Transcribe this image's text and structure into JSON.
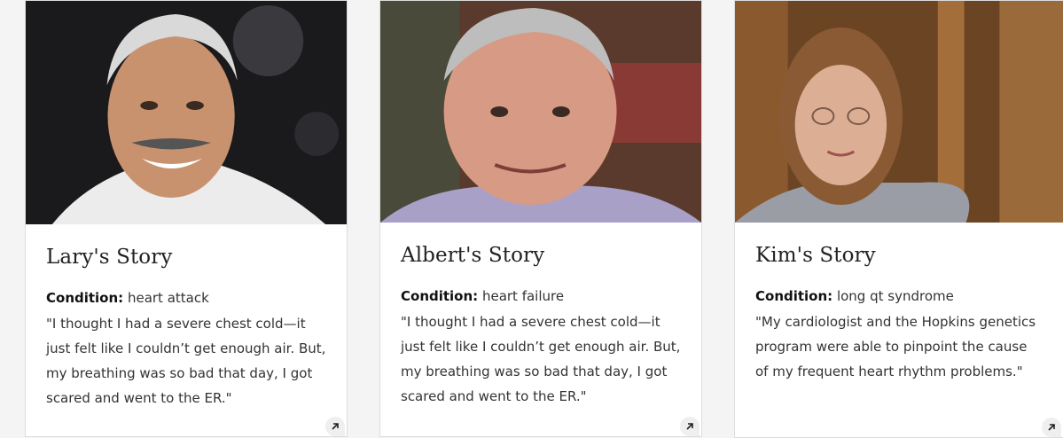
{
  "cards": [
    {
      "title": "Lary's Story",
      "condition_label": "Condition:",
      "condition_value": "heart attack",
      "quote": "\"I thought I had a severe chest cold—it just felt like I couldn’t get enough air. But, my breathing was so bad that day, I got scared and went to the ER.\"",
      "photo_alt": "Portrait of Lary",
      "link_icon": "arrow-up-right-icon"
    },
    {
      "title": "Albert's Story",
      "condition_label": "Condition:",
      "condition_value": "heart failure",
      "quote": "\"I thought I had a severe chest cold—it just felt like I couldn’t get enough air. But, my breathing was so bad that day, I got scared and went to the ER.\"",
      "photo_alt": "Portrait of Albert",
      "link_icon": "arrow-up-right-icon"
    },
    {
      "title": "Kim's Story",
      "condition_label": "Condition:",
      "condition_value": "long qt syndrome",
      "quote": "\"My cardiologist and the Hopkins genetics program were able to pinpoint the cause of my frequent heart rhythm problems.\"",
      "photo_alt": "Portrait of Kim",
      "link_icon": "arrow-up-right-icon"
    }
  ],
  "colors": {
    "background": "#f4f4f4",
    "card": "#ffffff",
    "text": "#333333"
  }
}
